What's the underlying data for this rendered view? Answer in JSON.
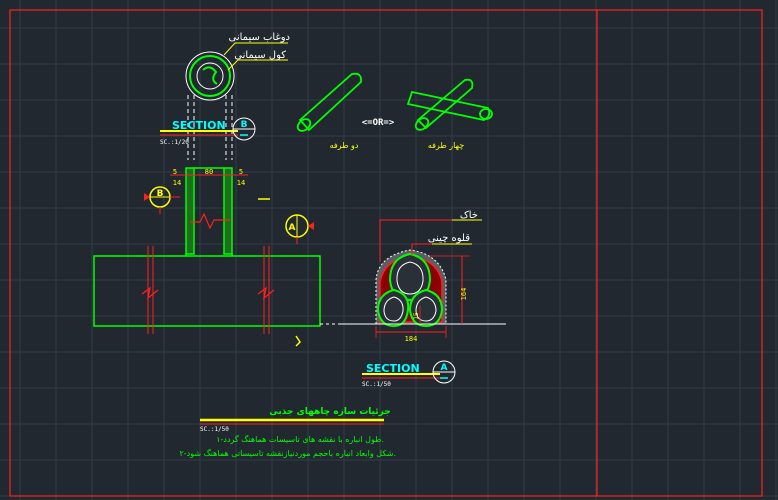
{
  "top_detail": {
    "label_top": "دوغاب سیمانی",
    "label_mid": "کول سیمانی",
    "section_title": "SECTION",
    "section_letter": "B",
    "section_scale": "SC.:1/20",
    "dim_width": "80",
    "dim_left_top": "5",
    "dim_left_bottom": "14",
    "dim_right_top": "5",
    "dim_right_bottom": "14"
  },
  "pipe_options": {
    "or_text": "<=OR=>",
    "left_caption": "دو طرفه",
    "right_caption": "چهار طرفه"
  },
  "markers": {
    "marker_b_letter": "B",
    "marker_a_letter": "A"
  },
  "section_a": {
    "label_soil": "خاک",
    "label_pipe": "قلوه چینی",
    "dim_height": "164",
    "dim_width": "184",
    "dim_small": "15",
    "section_title": "SECTION",
    "section_letter": "A",
    "section_scale": "SC.:1/50"
  },
  "notes": {
    "title": "جزئیات سازه چاههای جذبی",
    "scale": "SC.:1/50",
    "line1": "۱-طول انباره با نقشه های تاسیسات هماهنگ گردد.",
    "line2": "۲-شکل وابعاد انباره باحجم موردنیازنقشه تاسیساتی هماهنگ شود."
  },
  "colors": {
    "background": "#212830",
    "grid": "#333c47",
    "frame": "#ff2020",
    "green": "#00ff00",
    "yellow": "#ffff00",
    "cyan": "#00ffff",
    "white": "#ffffff",
    "red": "#ff0000"
  }
}
